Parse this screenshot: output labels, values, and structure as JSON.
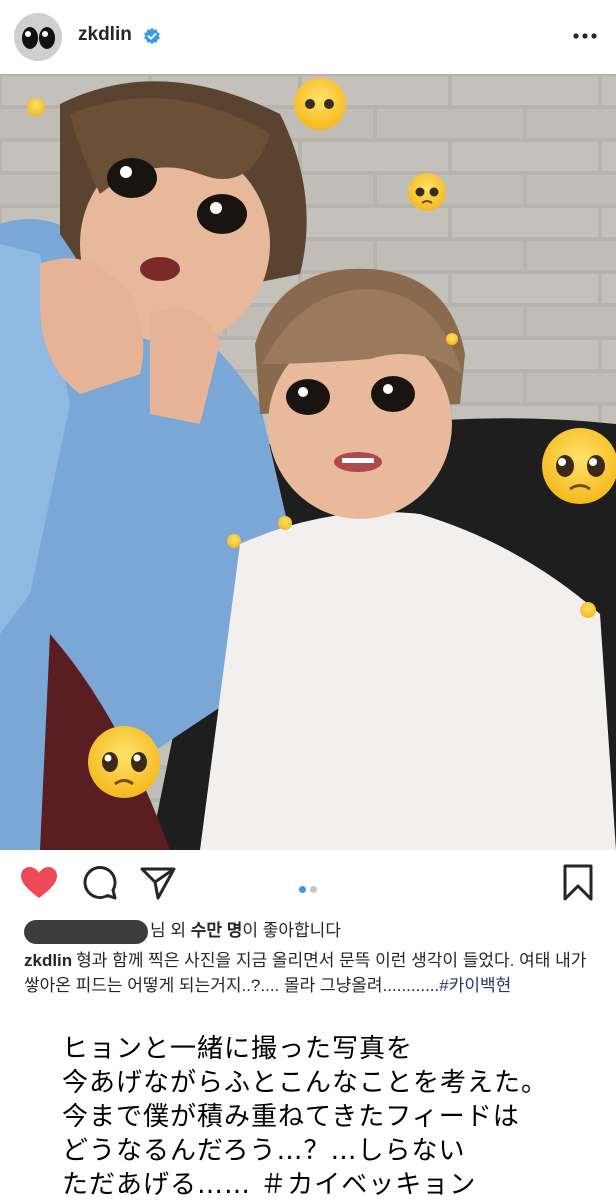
{
  "header": {
    "username": "zkdlin",
    "avatar_icon": "avatar-eyes-icon",
    "verified_icon": "verified-badge-icon",
    "more_icon": "more-options-icon"
  },
  "post": {
    "image_description_icon": "selfie-photo-with-pleading-face-stickers",
    "carousel": {
      "count": 2,
      "active": 1,
      "active_color": "#3897f0",
      "inactive_color": "#c7c7c7"
    }
  },
  "actions": {
    "like_icon": "heart-filled-icon",
    "like_color": "#ed4956",
    "comment_icon": "comment-icon",
    "share_icon": "share-icon",
    "save_icon": "bookmark-icon"
  },
  "likes": {
    "prefix": "님 외 ",
    "count": "수만 명",
    "suffix": "이 좋아합니다"
  },
  "caption": {
    "username": "zkdlin",
    "text": "형과 함께 찍은 사진을 지금 올리면서 문뜩 이런 생각이 들었다. 여태 내가 쌓아온 피드는 어떻게 되는거지..?.... 몰라 그냥올려............",
    "hashtag": "#카이백현"
  },
  "translation": {
    "lines": [
      "ヒョンと一緒に撮った写真を",
      "今あげながらふとこんなことを考えた。",
      "今まで僕が積み重ねてきたフィードは",
      "どうなるんだろう…？…しらない",
      "ただあげる…… ＃カイベッキョン"
    ]
  }
}
